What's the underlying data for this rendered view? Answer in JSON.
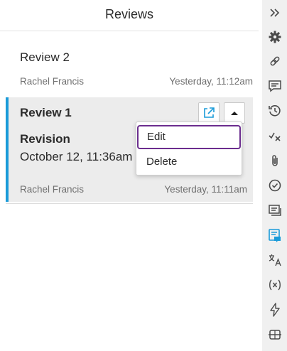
{
  "panel": {
    "title": "Reviews"
  },
  "reviews": [
    {
      "title": "Review 2",
      "author": "Rachel Francis",
      "time": "Yesterday, 11:12am"
    },
    {
      "title": "Review 1",
      "revision_label": "Revision",
      "revision_date": "October 12, 11:36am",
      "author": "Rachel Francis",
      "time": "Yesterday, 11:11am"
    }
  ],
  "menu": {
    "items": [
      "Edit",
      "Delete"
    ]
  },
  "colors": {
    "accent": "#1a9bd9",
    "focus": "#6b2d8e",
    "sidebar_bg": "#f0f0f0",
    "active_bg": "#ececec",
    "icon": "#4a4a4a"
  },
  "sidebar": {
    "icons": [
      "collapse-icon",
      "gear-icon",
      "link-icon",
      "comment-icon",
      "history-icon",
      "track-changes-icon",
      "attachment-icon",
      "check-circle-icon",
      "review-list-icon",
      "reviews-panel-icon",
      "translate-icon",
      "variable-icon",
      "lightning-icon",
      "split-icon"
    ]
  }
}
